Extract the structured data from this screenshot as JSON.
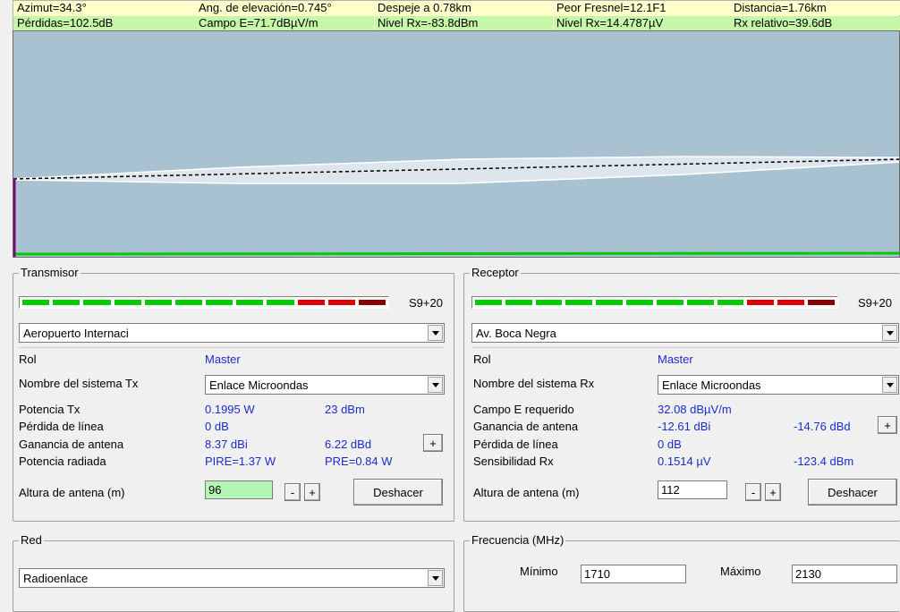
{
  "status": {
    "row1": [
      "Azimut=34.3°",
      "Ang. de elevación=0.745°",
      "Despeje a 0.78km",
      "Peor Fresnel=12.1F1",
      "Distancia=1.76km"
    ],
    "row2": [
      "Pérdidas=102.5dB",
      "Campo E=71.7dBµV/m",
      "Nivel Rx=-83.8dBm",
      "Nivel Rx=14.4787µV",
      "Rx relativo=39.6dB"
    ]
  },
  "colors": {
    "profile_bg": "#a9c2d1",
    "terrain": "#00cc00",
    "ray": "#000000",
    "fresnel": "#ffffff",
    "antenna": "#800080",
    "field_green": "#b5f5b5",
    "bar_green": "#00cc00",
    "bar_red": "#e00000",
    "bar_darkred": "#8b0000",
    "label_blue": "#1a2ccc"
  },
  "transmitter": {
    "title": "Transmisor",
    "signal_label": "S9+20",
    "signal_segments": [
      "green",
      "green",
      "green",
      "green",
      "green",
      "green",
      "green",
      "green",
      "green",
      "red",
      "red",
      "darkred"
    ],
    "station": "Aeropuerto Internaci",
    "rol_label": "Rol",
    "rol_value": "Master",
    "system_label": "Nombre del sistema Tx",
    "system_value": "Enlace Microondas",
    "power_label": "Potencia Tx",
    "power_w": "0.1995 W",
    "power_dbm": "23 dBm",
    "loss_label": "Pérdida de línea",
    "loss_value": "0 dB",
    "gain_label": "Ganancia de antena",
    "gain_dbi": "8.37 dBi",
    "gain_dbd": "6.22 dBd",
    "radiated_label": "Potencia radiada",
    "pire": "PIRE=1.37 W",
    "pre": "PRE=0.84 W",
    "height_label": "Altura de antena (m)",
    "height_value": "96",
    "minus": "-",
    "plus": "+",
    "undo": "Deshacer"
  },
  "receiver": {
    "title": "Receptor",
    "signal_label": "S9+20",
    "signal_segments": [
      "green",
      "green",
      "green",
      "green",
      "green",
      "green",
      "green",
      "green",
      "green",
      "red",
      "red",
      "darkred"
    ],
    "station": "Av. Boca Negra",
    "rol_label": "Rol",
    "rol_value": "Master",
    "system_label": "Nombre del sistema Rx",
    "system_value": "Enlace Microondas",
    "field_label": "Campo E requerido",
    "field_value": "32.08 dBµV/m",
    "gain_label": "Ganancia de antena",
    "gain_dbi": "-12.61 dBi",
    "gain_dbd": "-14.76 dBd",
    "loss_label": "Pérdida de línea",
    "loss_value": "0 dB",
    "sens_label": "Sensibilidad Rx",
    "sens_uv": "0.1514 µV",
    "sens_dbm": "-123.4 dBm",
    "height_label": "Altura de antena (m)",
    "height_value": "112",
    "minus": "-",
    "plus": "+",
    "undo": "Deshacer"
  },
  "network": {
    "title": "Red",
    "value": "Radioenlace"
  },
  "frequency": {
    "title": "Frecuencia (MHz)",
    "min_label": "Mínimo",
    "min_value": "1710",
    "max_label": "Máximo",
    "max_value": "2130"
  }
}
